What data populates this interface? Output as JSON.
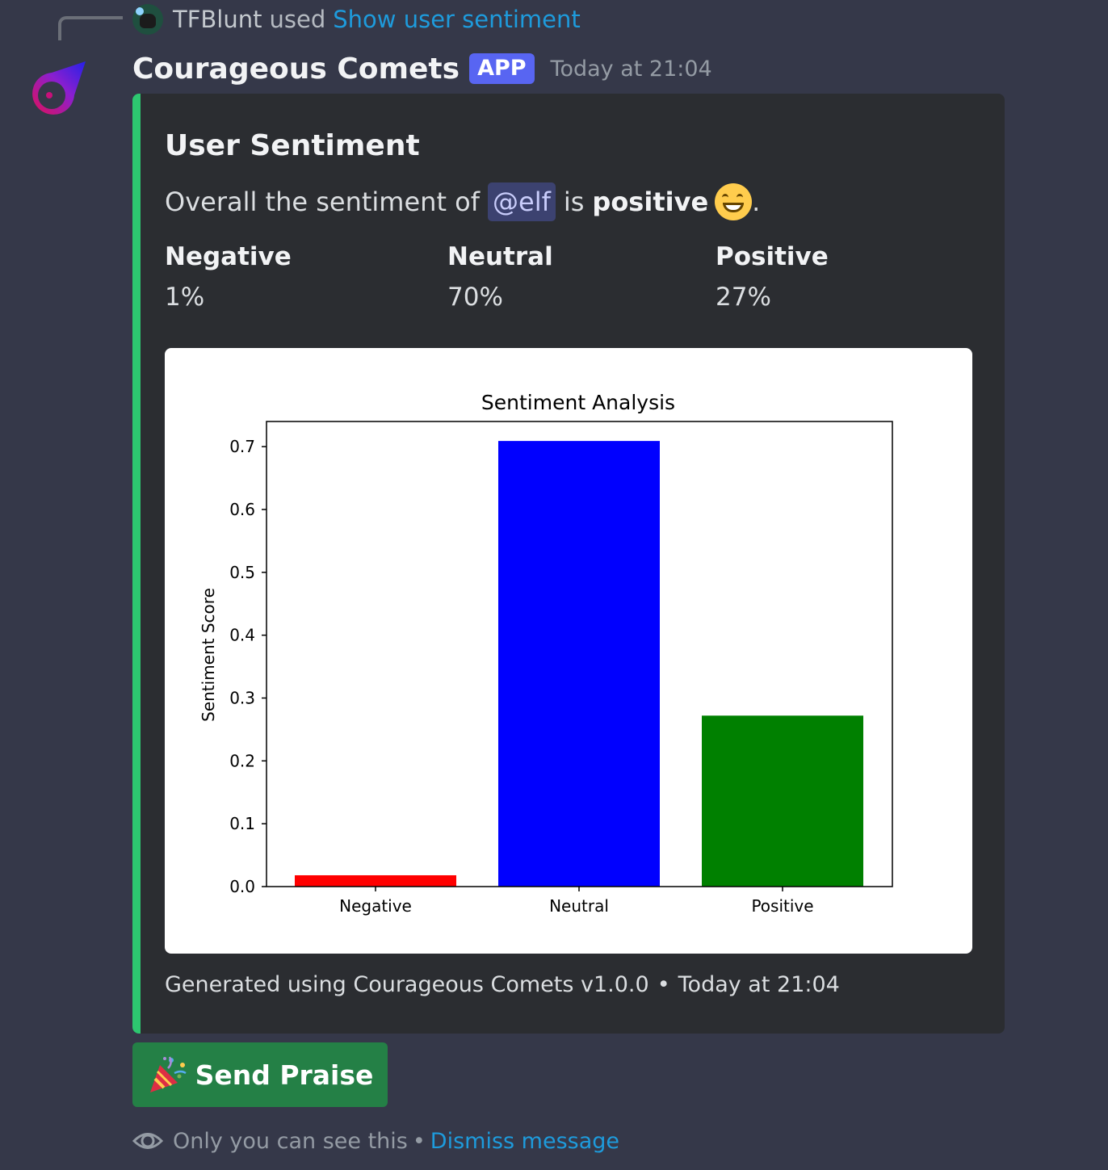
{
  "reply": {
    "user": "TFBlunt",
    "used": "used",
    "command": "Show user sentiment"
  },
  "message": {
    "author": "Courageous Comets",
    "badge": "APP",
    "timestamp": "Today at 21:04"
  },
  "embed": {
    "accent_color": "#2dc770",
    "title": "User Sentiment",
    "description_prefix": "Overall the sentiment of",
    "mention": "@elf",
    "description_is": "is",
    "sentiment_word": "positive",
    "description_end": ".",
    "fields": [
      {
        "name": "Negative",
        "value": "1%"
      },
      {
        "name": "Neutral",
        "value": "70%"
      },
      {
        "name": "Positive",
        "value": "27%"
      }
    ],
    "footer_text": "Generated using Courageous Comets v1.0.0",
    "footer_sep": "•",
    "footer_time": "Today at 21:04"
  },
  "chart_data": {
    "type": "bar",
    "title": "Sentiment Analysis",
    "xlabel": "",
    "ylabel": "Sentiment Score",
    "categories": [
      "Negative",
      "Neutral",
      "Positive"
    ],
    "values": [
      0.018,
      0.709,
      0.272
    ],
    "colors": [
      "#ff0000",
      "#0000ff",
      "#008000"
    ],
    "ylim": [
      0,
      0.74
    ],
    "yticks": [
      "0.0",
      "0.1",
      "0.2",
      "0.3",
      "0.4",
      "0.5",
      "0.6",
      "0.7"
    ],
    "grid": false
  },
  "button": {
    "label": "Send Praise",
    "emoji": "party-popper-icon"
  },
  "ephemeral": {
    "text": "Only you can see this",
    "sep": "•",
    "dismiss": "Dismiss message"
  }
}
